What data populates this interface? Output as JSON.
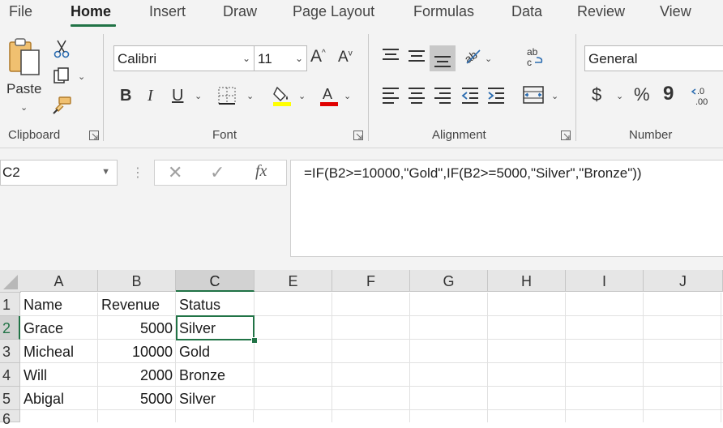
{
  "ribbon_tabs": [
    "File",
    "Home",
    "Insert",
    "Draw",
    "Page Layout",
    "Formulas",
    "Data",
    "Review",
    "View"
  ],
  "active_tab": "Home",
  "clipboard": {
    "paste_label": "Paste",
    "group_label": "Clipboard"
  },
  "font": {
    "name": "Calibri",
    "size": "11",
    "group_label": "Font",
    "bold": "B",
    "italic": "I",
    "underline": "U",
    "grow": "A",
    "shrink": "A"
  },
  "alignment": {
    "group_label": "Alignment"
  },
  "number": {
    "format": "General",
    "group_label": "Number",
    "currency": "$",
    "percent": "%",
    "comma": "9"
  },
  "name_box": "C2",
  "formula_bar": {
    "fx": "fx",
    "formula": "=IF(B2>=10000,\"Gold\",IF(B2>=5000,\"Silver\",\"Bronze\"))"
  },
  "columns": [
    "A",
    "B",
    "C",
    "E",
    "F",
    "G",
    "H",
    "I",
    "J"
  ],
  "rows": [
    "1",
    "2",
    "3",
    "4",
    "5",
    "6"
  ],
  "table": [
    [
      "Name",
      "Revenue",
      "Status"
    ],
    [
      "Grace",
      "5000",
      "Silver"
    ],
    [
      "Micheal",
      "10000",
      "Gold"
    ],
    [
      "Will",
      "2000",
      "Bronze"
    ],
    [
      "Abigal",
      "5000",
      "Silver"
    ]
  ],
  "colors": {
    "accent": "#217346",
    "ribbon_bg": "#f3f3f3",
    "header_bg": "#e6e6e6",
    "highlight": "#ffff00",
    "font_color": "#e00000"
  }
}
